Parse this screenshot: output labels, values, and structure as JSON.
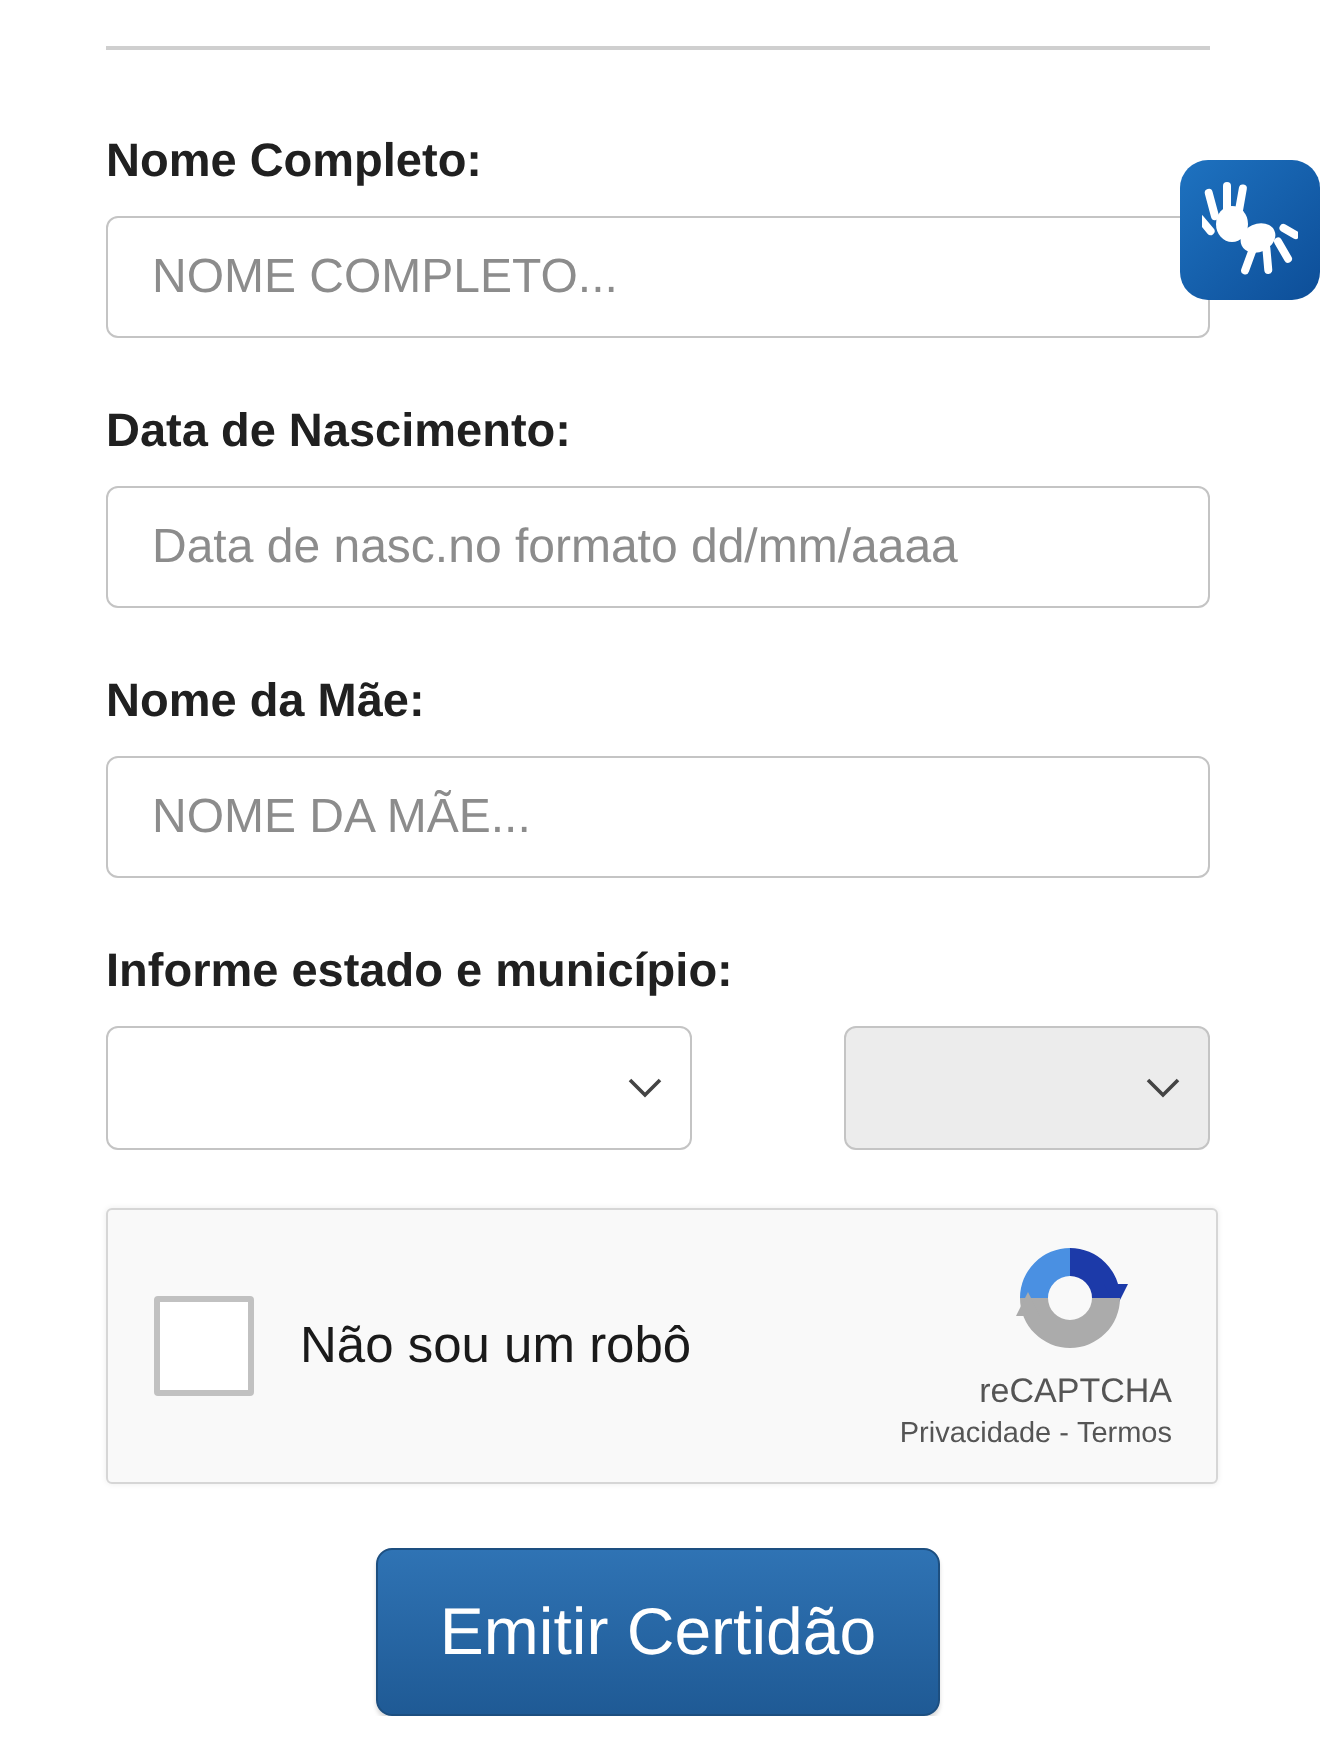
{
  "fields": [
    {
      "label": "Nome Completo:",
      "placeholder": "NOME COMPLETO..."
    },
    {
      "label": "Data de Nascimento:",
      "placeholder": "Data de nasc.no formato dd/mm/aaaa"
    },
    {
      "label": "Nome da Mãe:",
      "placeholder": "NOME DA MÃE..."
    }
  ],
  "location": {
    "label": "Informe estado e município:",
    "selects": [
      {
        "disabled": false
      },
      {
        "disabled": true
      }
    ]
  },
  "captcha": {
    "label": "Não sou um robô",
    "checked": false,
    "brand": "reCAPTCHA",
    "links": [
      "Privacidade",
      "Termos"
    ],
    "separator": "-"
  },
  "submit": {
    "label": "Emitir Certidão"
  }
}
